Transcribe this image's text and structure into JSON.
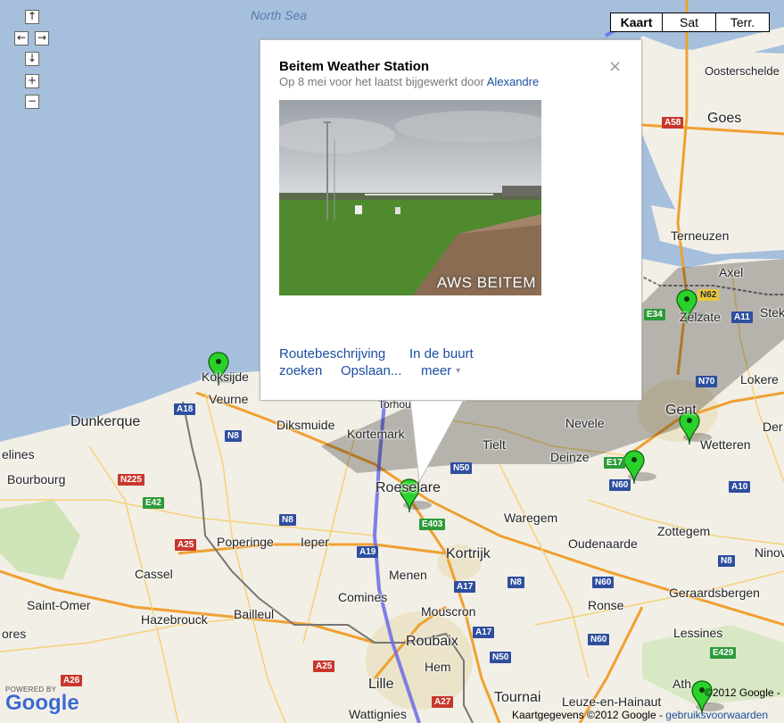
{
  "map": {
    "water_color": "#a5bfdd",
    "land_color": "#f2efe6",
    "place_labels": [
      {
        "id": "north-sea",
        "text": "North Sea"
      },
      {
        "id": "oosterschelde",
        "text": "Oosterschelde"
      },
      {
        "id": "goes",
        "text": "Goes"
      },
      {
        "id": "terneuzen",
        "text": "Terneuzen"
      },
      {
        "id": "axel",
        "text": "Axel"
      },
      {
        "id": "zelzate",
        "text": "Zelzate"
      },
      {
        "id": "stek",
        "text": "Stek"
      },
      {
        "id": "lokeren",
        "text": "Lokere"
      },
      {
        "id": "gent",
        "text": "Gent"
      },
      {
        "id": "nevele",
        "text": "Nevele"
      },
      {
        "id": "wetteren",
        "text": "Wetteren"
      },
      {
        "id": "dendermonde",
        "text": "Der"
      },
      {
        "id": "deinze",
        "text": "Deinze"
      },
      {
        "id": "tielt",
        "text": "Tielt"
      },
      {
        "id": "koksijde",
        "text": "Koksijde"
      },
      {
        "id": "veurne",
        "text": "Veurne"
      },
      {
        "id": "dunkerque",
        "text": "Dunkerque"
      },
      {
        "id": "diksmuide",
        "text": "Diksmuide"
      },
      {
        "id": "kortemark",
        "text": "Kortemark"
      },
      {
        "id": "torhout",
        "text": "Torhout"
      },
      {
        "id": "roeselare",
        "text": "Roeselare"
      },
      {
        "id": "grande-synthe",
        "text": "elines"
      },
      {
        "id": "bourbourg",
        "text": "Bourbourg"
      },
      {
        "id": "waregem",
        "text": "Waregem"
      },
      {
        "id": "zottegem",
        "text": "Zottegem"
      },
      {
        "id": "ninove",
        "text": "Ninov"
      },
      {
        "id": "oudenaarde",
        "text": "Oudenaarde"
      },
      {
        "id": "poperinge",
        "text": "Poperinge"
      },
      {
        "id": "ieper",
        "text": "Ieper"
      },
      {
        "id": "kortrijk",
        "text": "Kortrijk"
      },
      {
        "id": "cassel",
        "text": "Cassel"
      },
      {
        "id": "menen",
        "text": "Menen"
      },
      {
        "id": "comines",
        "text": "Comines"
      },
      {
        "id": "saint-omer",
        "text": "Saint-Omer"
      },
      {
        "id": "hazebrouck",
        "text": "Hazebrouck"
      },
      {
        "id": "bailleul",
        "text": "Bailleul"
      },
      {
        "id": "mouscron",
        "text": "Mouscron"
      },
      {
        "id": "ronse",
        "text": "Ronse"
      },
      {
        "id": "geraardsbergen",
        "text": "Geraardsbergen"
      },
      {
        "id": "lessines",
        "text": "Lessines"
      },
      {
        "id": "roubaix",
        "text": "Roubaix"
      },
      {
        "id": "hem",
        "text": "Hem"
      },
      {
        "id": "lille",
        "text": "Lille"
      },
      {
        "id": "tournai",
        "text": "Tournai"
      },
      {
        "id": "leuze",
        "text": "Leuze-en-Hainaut"
      },
      {
        "id": "ath",
        "text": "Ath"
      },
      {
        "id": "wattignies",
        "text": "Wattignies"
      },
      {
        "id": "aire",
        "text": "ores"
      }
    ],
    "road_shields": [
      {
        "id": "a58",
        "text": "A58",
        "color": "red"
      },
      {
        "id": "n62",
        "text": "N62",
        "color": "yellow"
      },
      {
        "id": "e34",
        "text": "E34",
        "color": "green"
      },
      {
        "id": "a11",
        "text": "A11",
        "color": "blue"
      },
      {
        "id": "n70",
        "text": "N70",
        "color": "blue"
      },
      {
        "id": "a18",
        "text": "A18",
        "color": "blue"
      },
      {
        "id": "n8-veurne",
        "text": "N8",
        "color": "blue"
      },
      {
        "id": "n225",
        "text": "N225",
        "color": "red"
      },
      {
        "id": "e42",
        "text": "E42",
        "color": "green"
      },
      {
        "id": "n50",
        "text": "N50",
        "color": "blue"
      },
      {
        "id": "e17",
        "text": "E17",
        "color": "green"
      },
      {
        "id": "n60",
        "text": "N60",
        "color": "blue"
      },
      {
        "id": "a10",
        "text": "A10",
        "color": "blue"
      },
      {
        "id": "e403",
        "text": "E403",
        "color": "green"
      },
      {
        "id": "n8-ieper",
        "text": "N8",
        "color": "blue"
      },
      {
        "id": "a25",
        "text": "A25",
        "color": "red"
      },
      {
        "id": "a19",
        "text": "A19",
        "color": "blue"
      },
      {
        "id": "n8-zott",
        "text": "N8",
        "color": "blue"
      },
      {
        "id": "a17",
        "text": "A17",
        "color": "blue"
      },
      {
        "id": "n8-kort",
        "text": "N8",
        "color": "blue"
      },
      {
        "id": "n60-b",
        "text": "N60",
        "color": "blue"
      },
      {
        "id": "a17-b",
        "text": "A17",
        "color": "blue"
      },
      {
        "id": "n60-c",
        "text": "N60",
        "color": "blue"
      },
      {
        "id": "e429",
        "text": "E429",
        "color": "green"
      },
      {
        "id": "n50-b",
        "text": "N50",
        "color": "blue"
      },
      {
        "id": "a25-b",
        "text": "A25",
        "color": "red"
      },
      {
        "id": "a26",
        "text": "A26",
        "color": "red"
      },
      {
        "id": "a27",
        "text": "A27",
        "color": "red"
      }
    ],
    "marker_count": 7
  },
  "controls": {
    "pan_up": "↑",
    "pan_left": "←",
    "pan_right": "→",
    "pan_down": "↓",
    "zoom_in": "+",
    "zoom_out": "−"
  },
  "map_types": [
    {
      "label": "Kaart",
      "active": true
    },
    {
      "label": "Sat",
      "active": false
    },
    {
      "label": "Terr.",
      "active": false
    }
  ],
  "popup": {
    "title": "Beitem Weather Station",
    "subtitle_prefix": "Op 8 mei voor het laatst bijgewerkt door ",
    "author": "Alexandre",
    "close_symbol": "×",
    "photo_caption": "AWS BEITEM",
    "links": {
      "directions": "Routebeschrijving",
      "nearby": "In de buurt",
      "search": "zoeken",
      "save": "Opslaan...",
      "more": "meer"
    }
  },
  "footer": {
    "logo_powered_by": "POWERED BY",
    "logo_text": "Google",
    "copyright_top": "©2012 Google -",
    "copyright_data": "Kaartgegevens ©2012 Google - ",
    "terms": "gebruiksvoorwaarden"
  }
}
